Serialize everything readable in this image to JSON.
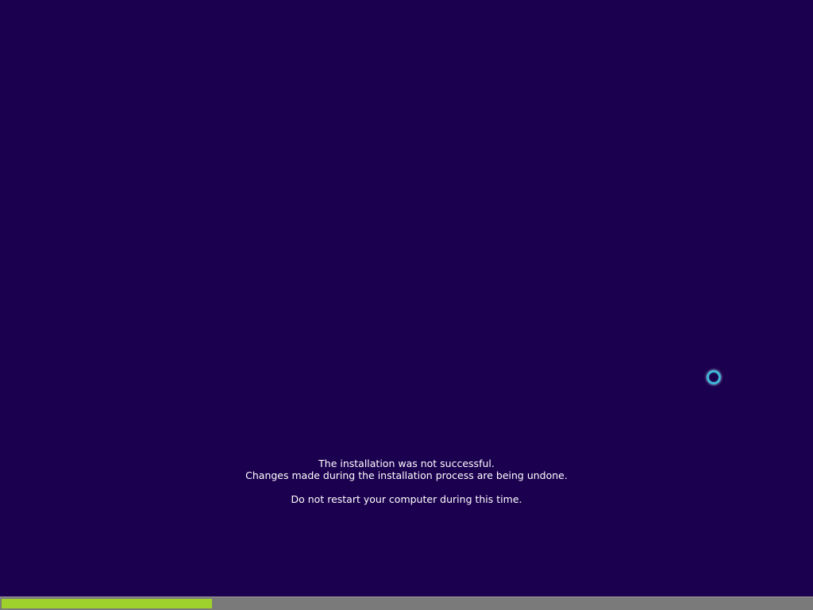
{
  "message": {
    "line1": "The installation was not successful.",
    "line2": "Changes made during the installation process are being undone.",
    "line3": "Do not restart your computer during this time."
  },
  "progress": {
    "fraction": 0.26
  },
  "colors": {
    "background": "#1b0050",
    "progress_fill": "#9fd12c",
    "progress_track": "#7a7a7a",
    "spinner": "#3fb8d8"
  },
  "icons": {
    "spinner": "loading-spinner-icon"
  }
}
